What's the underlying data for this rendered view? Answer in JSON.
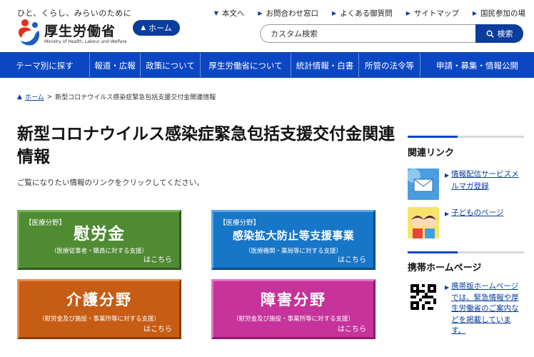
{
  "header": {
    "tagline": "ひと、くらし、みらいのために",
    "org_name": "厚生労働省",
    "org_name_en": "Ministry of Health, Labour and Welfare",
    "home_label": "ホーム",
    "top_links": [
      "本文へ",
      "お問合わせ窓口",
      "よくある御質問",
      "サイトマップ",
      "国民参加の場"
    ],
    "search_placeholder": "カスタム検索",
    "search_button": "検索"
  },
  "nav": {
    "items": [
      "テーマ別に探す",
      "報道・広報",
      "政策について",
      "厚生労働省について",
      "統計情報・白書",
      "所管の法令等",
      "申請・募集・情報公開"
    ]
  },
  "breadcrumb": {
    "home": "ホーム",
    "separator": ">",
    "current": "新型コロナウイルス感染症緊急包括支援交付金関連情報"
  },
  "main": {
    "title": "新型コロナウイルス感染症緊急包括支援交付金関連情報",
    "intro": "ご覧になりたい情報のリンクをクリックしてください。",
    "cards": [
      {
        "tag": "【医療分野】",
        "heading": "慰労金",
        "sub": "（医療従事者・職員に対する支援）",
        "more": "はこちら"
      },
      {
        "tag": "【医療分野】",
        "heading": "感染拡大防止等支援事業",
        "sub": "（医療機関・薬局等に対する支援）",
        "more": "はこちら"
      },
      {
        "tag": "",
        "heading": "介護分野",
        "sub": "（慰労金及び施設・事業所等に対する支援）",
        "more": "はこちら"
      },
      {
        "tag": "",
        "heading": "障害分野",
        "sub": "（慰労金及び施設・事業所等に対する支援）",
        "more": "はこちら"
      }
    ]
  },
  "sidebar": {
    "related_title": "関連リンク",
    "related_links": [
      {
        "label": "情報配信サービスメルマガ登録",
        "icon": "mail-icon"
      },
      {
        "label": "子どものページ",
        "icon": "kids-icon"
      }
    ],
    "mobile_title": "携帯ホームページ",
    "mobile_text": "携帯版ホームページでは、緊急情報や厚生労働省のご案内などを掲載しています。",
    "mobile_icon": "qr-code-icon"
  },
  "colors": {
    "brand": "#0a3d9c",
    "nav": "#0b47c2",
    "card_medical": "#4f8b32",
    "card_infection": "#1776c8",
    "card_care": "#c75c14",
    "card_disability": "#c6339a"
  }
}
